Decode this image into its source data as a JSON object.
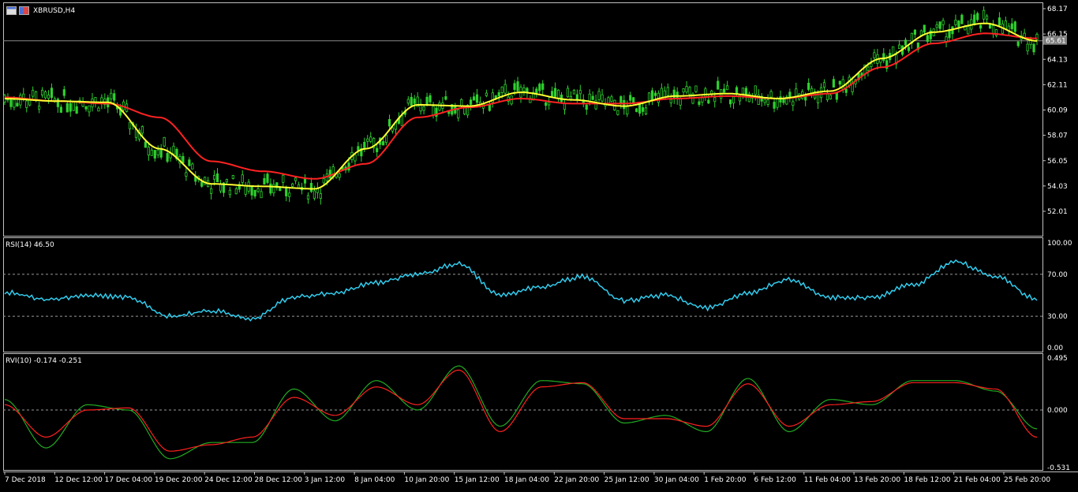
{
  "window": {
    "title": "XBRUSD,H4",
    "icons": [
      "table-icon",
      "flag-icon"
    ]
  },
  "colors": {
    "background": "#000000",
    "frame": "#c0c0c0",
    "bull_candle": "#2fd12f",
    "bear_candle": "#2fd12f",
    "ma_fast": "#ffff33",
    "ma_slow": "#ff2222",
    "rsi_line": "#33ccee",
    "rvi_main": "#22aa22",
    "rvi_signal": "#ff2020",
    "price_label_bg": "#808080"
  },
  "price_pane": {
    "current_price_label": "65.61",
    "current_price": 65.61,
    "y_ticks": [
      "68.17",
      "66.15",
      "64.13",
      "62.11",
      "60.09",
      "58.07",
      "56.05",
      "54.03",
      "52.01"
    ],
    "ylim": [
      50.8,
      68.5
    ]
  },
  "rsi_pane": {
    "label": "RSI(14) 46.50",
    "y_ticks": [
      "100.00",
      "70.00",
      "30.00",
      "0.00"
    ],
    "levels": [
      70,
      30
    ]
  },
  "rvi_pane": {
    "label": "RVI(10) -0.174 -0.251",
    "y_ticks": [
      "0.495",
      "0.000",
      "-0.531"
    ],
    "ylim": [
      -0.531,
      0.495
    ]
  },
  "x_axis": {
    "labels": [
      "7 Dec 2018",
      "12 Dec 12:00",
      "17 Dec 04:00",
      "19 Dec 20:00",
      "24 Dec 12:00",
      "28 Dec 12:00",
      "3 Jan 12:00",
      "8 Jan 04:00",
      "10 Jan 20:00",
      "15 Jan 12:00",
      "18 Jan 04:00",
      "22 Jan 20:00",
      "25 Jan 12:00",
      "30 Jan 04:00",
      "1 Feb 20:00",
      "6 Feb 12:00",
      "11 Feb 04:00",
      "13 Feb 20:00",
      "18 Feb 12:00",
      "21 Feb 04:00",
      "25 Feb 20:00"
    ]
  },
  "chart_data": [
    {
      "type": "line",
      "pane": "price",
      "x": [
        0,
        5,
        10,
        15,
        20,
        25,
        30,
        35,
        40,
        45,
        50,
        55,
        60,
        65,
        70,
        75,
        80,
        85,
        90,
        95,
        100
      ],
      "series": [
        {
          "values": [
            61.0,
            60.8,
            60.7,
            57.0,
            54.2,
            54.0,
            53.8,
            57.0,
            60.5,
            60.4,
            61.5,
            60.9,
            60.4,
            61.2,
            61.4,
            61.0,
            61.6,
            64.2,
            66.3,
            67.0,
            65.6
          ]
        },
        {
          "values": [
            61.1,
            60.8,
            60.6,
            59.5,
            56.0,
            55.2,
            54.6,
            55.8,
            59.5,
            60.3,
            61.0,
            60.6,
            60.6,
            61.0,
            61.2,
            61.0,
            61.4,
            63.5,
            65.4,
            66.2,
            65.8
          ]
        }
      ],
      "ylim": [
        50.8,
        68.5
      ]
    },
    {
      "type": "line",
      "pane": "rsi",
      "x": [
        0,
        4,
        8,
        12,
        16,
        20,
        24,
        28,
        32,
        36,
        40,
        44,
        48,
        52,
        56,
        60,
        64,
        68,
        72,
        76,
        80,
        84,
        88,
        92,
        96,
        100
      ],
      "series": [
        {
          "values": [
            53,
            46,
            50,
            48,
            30,
            35,
            28,
            48,
            52,
            62,
            70,
            80,
            50,
            58,
            68,
            45,
            50,
            38,
            52,
            65,
            48,
            48,
            60,
            82,
            68,
            46.5
          ]
        }
      ],
      "ylim": [
        0,
        100
      ]
    },
    {
      "type": "line",
      "pane": "rvi",
      "x": [
        0,
        4,
        8,
        12,
        16,
        20,
        24,
        28,
        32,
        36,
        40,
        44,
        48,
        52,
        56,
        60,
        64,
        68,
        72,
        76,
        80,
        84,
        88,
        92,
        96,
        100
      ],
      "series": [
        {
          "values": [
            0.1,
            -0.35,
            0.05,
            0.0,
            -0.45,
            -0.3,
            -0.3,
            0.2,
            -0.1,
            0.28,
            0.0,
            0.42,
            -0.15,
            0.28,
            0.25,
            -0.12,
            -0.05,
            -0.2,
            0.3,
            -0.2,
            0.1,
            0.05,
            0.28,
            0.28,
            0.18,
            -0.174
          ]
        },
        {
          "values": [
            0.05,
            -0.25,
            0.0,
            0.02,
            -0.38,
            -0.32,
            -0.25,
            0.12,
            -0.05,
            0.22,
            0.05,
            0.38,
            -0.2,
            0.22,
            0.26,
            -0.08,
            -0.08,
            -0.15,
            0.25,
            -0.15,
            0.05,
            0.08,
            0.26,
            0.26,
            0.2,
            -0.251
          ]
        }
      ],
      "ylim": [
        -0.531,
        0.495
      ]
    }
  ]
}
